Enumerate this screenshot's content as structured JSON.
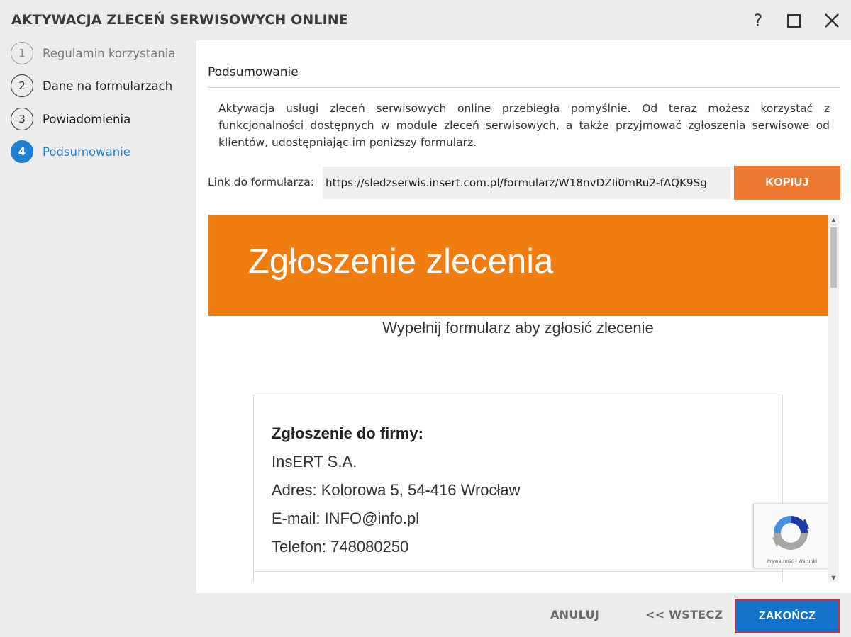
{
  "window": {
    "title": "AKTYWACJA ZLECEŃ SERWISOWYCH ONLINE",
    "help_label": "?"
  },
  "steps": [
    {
      "num": "1",
      "label": "Regulamin korzystania",
      "state": "done"
    },
    {
      "num": "2",
      "label": "Dane na formularzach",
      "state": "done"
    },
    {
      "num": "3",
      "label": "Powiadomienia",
      "state": "done"
    },
    {
      "num": "4",
      "label": "Podsumowanie",
      "state": "active"
    }
  ],
  "main": {
    "section_title": "Podsumowanie",
    "summary": "Aktywacja usługi zleceń serwisowych online przebiegła pomyślnie. Od teraz możesz korzystać z funkcjonalności dostępnych w module zleceń serwisowych, a także przyjmować zgłoszenia serwisowe od klientów, udostępniając im poniższy formularz.",
    "link_label": "Link do formularza:",
    "link_value": "https://sledzserwis.insert.com.pl/formularz/W18nvDZIi0mRu2-fAQK9Sg",
    "copy_label": "KOPIUJ"
  },
  "preview": {
    "banner_title": "Zgłoszenie zlecenia",
    "subtitle": "Wypełnij formularz aby zgłosić zlecenie",
    "card": {
      "heading": "Zgłoszenie do firmy:",
      "company": "InsERT S.A.",
      "address": "Adres: Kolorowa 5, 54-416 Wrocław",
      "email": "E-mail: INFO@info.pl",
      "phone": "Telefon: 748080250"
    },
    "recaptcha_text": "Prywatność - Warunki"
  },
  "footer": {
    "cancel_label": "ANULUJ",
    "back_label": "<< WSTECZ",
    "finish_label": "ZAKOŃCZ"
  },
  "colors": {
    "accent_blue": "#1f7fd0",
    "copy_orange": "#ec7a32",
    "banner_orange": "#ef7d10",
    "finish_blue": "#1572c9",
    "focus_red": "#d22c3a"
  }
}
